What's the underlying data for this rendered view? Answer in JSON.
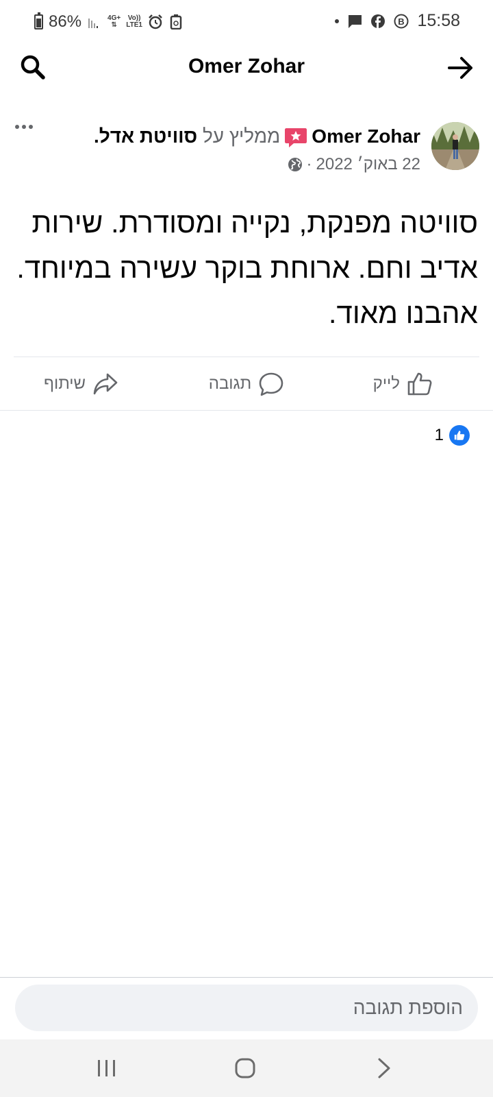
{
  "status_bar": {
    "battery": "86%",
    "network": "4G+",
    "volte": "Vo))",
    "lte": "LTE1",
    "time": "15:58",
    "icons": [
      "signal-icon",
      "alarm-icon",
      "recycle-icon",
      "message-icon",
      "facebook-icon",
      "b-icon"
    ]
  },
  "header": {
    "title": "Omer Zohar",
    "search_icon": "search-icon",
    "back_icon": "arrow-right-icon"
  },
  "post": {
    "author": "Omer Zohar",
    "recommends_text": "ממליץ על",
    "page_name": "סוויטת אדל",
    "trailing_period": ".",
    "date": "22 באוק׳ 2022",
    "separator": "·",
    "privacy_icon": "globe-icon",
    "more_icon": "more-options-icon",
    "text": "סוויטה מפנקת, נקייה ומסודרת. שירות אדיב וחם. ארוחת בוקר עשירה במיוחד. אהבנו מאוד."
  },
  "actions": {
    "like": "לייק",
    "comment": "תגובה",
    "share": "שיתוף"
  },
  "reactions": {
    "count": "1",
    "type": "like"
  },
  "comment_input": {
    "placeholder": "הוספת תגובה"
  },
  "colors": {
    "accent": "#1877f2",
    "badge": "#e8456a",
    "secondary_text": "#65676b"
  }
}
